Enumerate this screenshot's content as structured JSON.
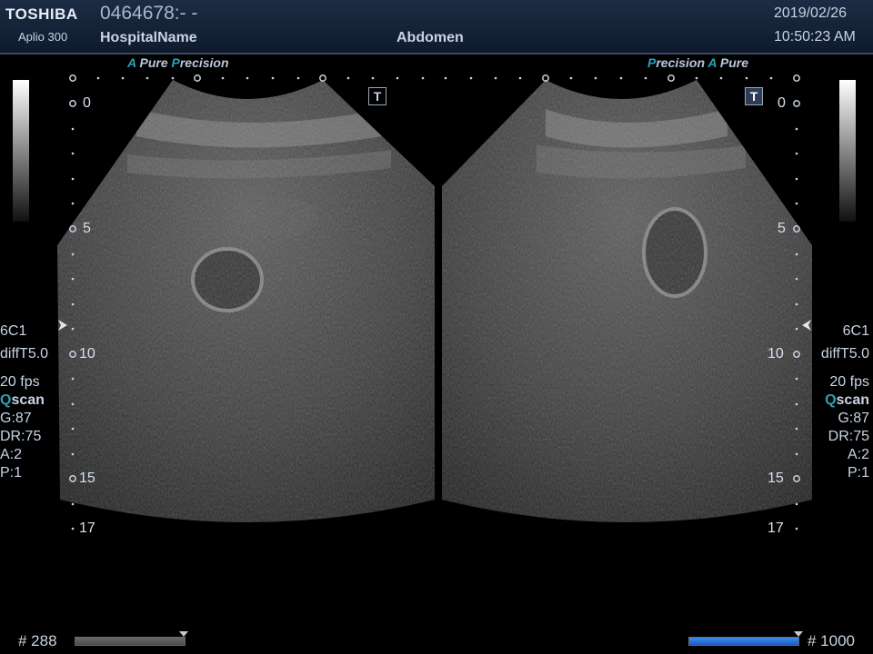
{
  "header": {
    "brand": "TOSHIBA",
    "model": "Aplio 300",
    "patient_id": "0464678:- -",
    "hospital": "HospitalName",
    "preset": "Abdomen",
    "date": "2019/02/26",
    "time": "10:50:23 AM"
  },
  "left_image": {
    "logo_a": "A",
    "logo_pure": "Pure",
    "logo_p": "P",
    "logo_precision": "recision",
    "depth_marks": [
      "0",
      "5",
      "10",
      "15",
      "17"
    ],
    "t_button": "T"
  },
  "right_image": {
    "logo_p": "P",
    "logo_precision": "recision",
    "logo_a": "A",
    "logo_pure": "Pure",
    "depth_marks": [
      "0",
      "5",
      "10",
      "15",
      "17"
    ],
    "t_button": "T"
  },
  "left_params": {
    "probe": "6C1",
    "mode": "diffT5.0",
    "fps": "20 fps",
    "qscan_q": "Q",
    "qscan_rest": "scan",
    "gain": "G:87",
    "dr": "DR:75",
    "a": "A:2",
    "p": "P:1"
  },
  "right_params": {
    "probe": "6C1",
    "mode": "diffT5.0",
    "fps": "20 fps",
    "qscan_q": "Q",
    "qscan_rest": "scan",
    "gain": "G:87",
    "dr": "DR:75",
    "a": "A:2",
    "p": "P:1"
  },
  "footer": {
    "left_frame": "# 288",
    "right_frame": "# 1000",
    "left_progress": 1.0,
    "right_progress": 1.0
  },
  "colors": {
    "header_bg": "#15233a",
    "accent_teal": "#2aa2b8",
    "progress_blue": "#2a72e0"
  }
}
